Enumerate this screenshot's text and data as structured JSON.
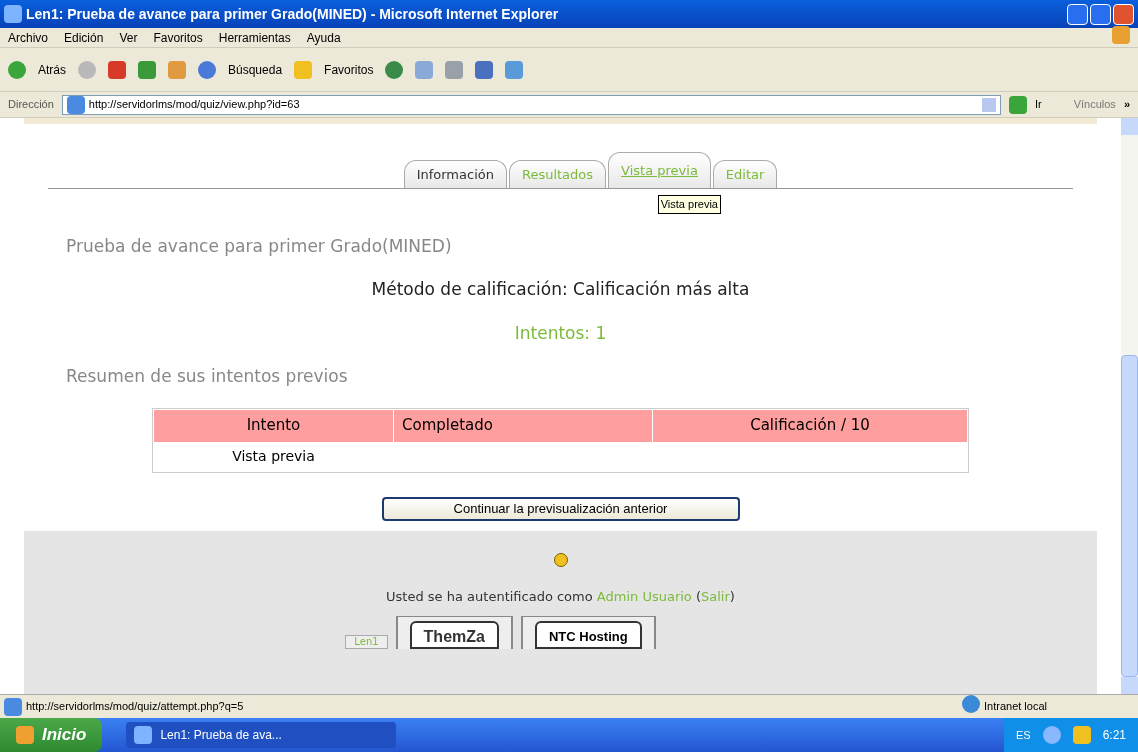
{
  "window": {
    "title": "Len1: Prueba de avance para primer Grado(MINED) - Microsoft Internet Explorer"
  },
  "menu": [
    "Archivo",
    "Edición",
    "Ver",
    "Favoritos",
    "Herramientas",
    "Ayuda"
  ],
  "toolbar": {
    "back": "Atrás",
    "search": "Búsqueda",
    "favorites": "Favoritos"
  },
  "address": {
    "label": "Dirección",
    "value": "http://servidorlms/mod/quiz/view.php?id=63",
    "go": "Ir",
    "links": "Vínculos",
    "more": "»"
  },
  "tabs": [
    {
      "label": "Información",
      "selected": true,
      "hovered": false
    },
    {
      "label": "Resultados",
      "selected": false,
      "hovered": false
    },
    {
      "label": "Vista previa",
      "selected": false,
      "hovered": true
    },
    {
      "label": "Editar",
      "selected": false,
      "hovered": false
    }
  ],
  "tooltip": "Vista previa",
  "heading": "Prueba de avance para primer Grado(MINED)",
  "grading": "Método de calificación: Calificación más alta",
  "attempts": "Intentos: 1",
  "summary_heading": "Resumen de sus intentos previos",
  "table": {
    "columns": [
      "Intento",
      "Completado",
      "Calificación / 10"
    ],
    "rows": [
      [
        "Vista previa"
      ]
    ]
  },
  "continue_button": "Continuar la previsualización anterior",
  "footer": {
    "login_text": "Usted se ha autentificado como",
    "user": "Admin Usuario",
    "open": "(",
    "logout": "Salir",
    "close": ")",
    "course": "Len1",
    "logos": [
      "ThemZa",
      "NTC Hosting"
    ]
  },
  "status_bar": {
    "url": "http://servidorlms/mod/quiz/attempt.php?q=5",
    "zone": "Intranet local"
  },
  "taskbar": {
    "start": "Inicio",
    "task": "Len1: Prueba de ava...",
    "lang": "ES",
    "time": "6:21"
  }
}
